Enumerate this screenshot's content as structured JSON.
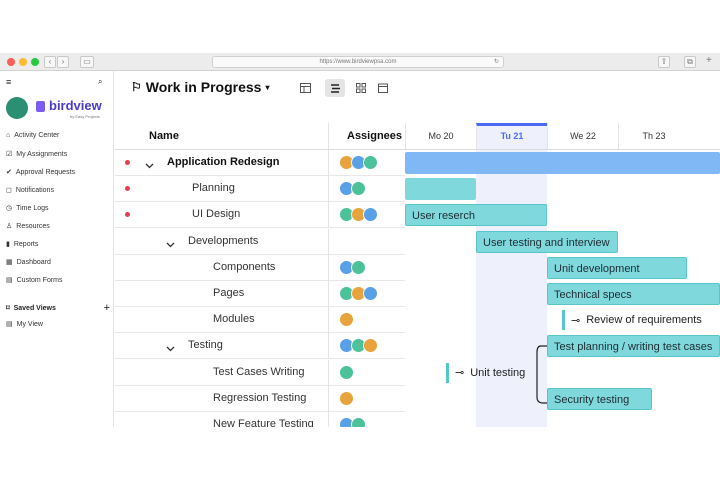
{
  "browser": {
    "url": "https://www.birdviewpsa.com"
  },
  "brand": {
    "name": "birdview",
    "tagline": "by Easy Projects",
    "accent": "#4b6cf0"
  },
  "sidebar": {
    "items": [
      {
        "label": "Activity Center",
        "icon": "home-icon"
      },
      {
        "label": "My Assignments",
        "icon": "checklist-icon"
      },
      {
        "label": "Approval Requests",
        "icon": "approval-icon"
      },
      {
        "label": "Notifications",
        "icon": "bell-icon"
      },
      {
        "label": "Time Logs",
        "icon": "clock-icon"
      },
      {
        "label": "Resources",
        "icon": "person-icon"
      },
      {
        "label": "Reports",
        "icon": "bar-chart-icon"
      },
      {
        "label": "Dashboard",
        "icon": "dashboard-icon"
      },
      {
        "label": "Custom Forms",
        "icon": "form-icon"
      }
    ],
    "saved_views_label": "Saved Views",
    "saved_views": [
      {
        "label": "My View",
        "icon": "view-icon"
      }
    ]
  },
  "header": {
    "title": "Work in Progress"
  },
  "columns": {
    "name": "Name",
    "assignees": "Assignees"
  },
  "days": [
    {
      "label": "Mo 20",
      "today": false
    },
    {
      "label": "Tu 21",
      "today": true
    },
    {
      "label": "We 22",
      "today": false
    },
    {
      "label": "Th 23",
      "today": false
    }
  ],
  "rows": [
    {
      "label": "Application Redesign",
      "level": 0,
      "expanded": true,
      "flag": true,
      "bold": true,
      "avatars": 3
    },
    {
      "label": "Planning",
      "level": 1,
      "flag": true,
      "avatars": 2
    },
    {
      "label": "UI Design",
      "level": 1,
      "flag": true,
      "avatars": 3
    },
    {
      "label": "Developments",
      "level": 1,
      "expanded": true,
      "avatars": 0
    },
    {
      "label": "Components",
      "level": 2,
      "avatars": 2
    },
    {
      "label": "Pages",
      "level": 2,
      "avatars": 3
    },
    {
      "label": "Modules",
      "level": 2,
      "avatars": 1
    },
    {
      "label": "Testing",
      "level": 1,
      "expanded": true,
      "avatars": 3
    },
    {
      "label": "Test Cases Writing",
      "level": 2,
      "avatars": 1
    },
    {
      "label": "Regression Testing",
      "level": 2,
      "avatars": 1
    },
    {
      "label": "New Feature Testing",
      "level": 2,
      "avatars": 2
    }
  ],
  "gantt": {
    "bars": [
      {
        "label": "",
        "row": 0,
        "color": "#7fb8f5"
      },
      {
        "label": "",
        "row": 1,
        "color": "#7fd9dc"
      },
      {
        "label": "User reserch",
        "row": 2
      },
      {
        "label": "User testing and interview",
        "row": 3
      },
      {
        "label": "Unit development",
        "row": 4
      },
      {
        "label": "Technical specs",
        "row": 5
      },
      {
        "label": "Test planning / writing test cases",
        "row": 7
      },
      {
        "label": "Security testing",
        "row": 9
      }
    ],
    "milestones": [
      {
        "label": "Review of  requirements",
        "row": 6
      },
      {
        "label": "Unit testing",
        "row": 8
      }
    ]
  },
  "colors": {
    "bar": "#7fd9dc",
    "summary": "#7fb8f5",
    "today_col": "#eef0fb",
    "today_line": "#4b6cf0",
    "flag": "#e04050"
  }
}
